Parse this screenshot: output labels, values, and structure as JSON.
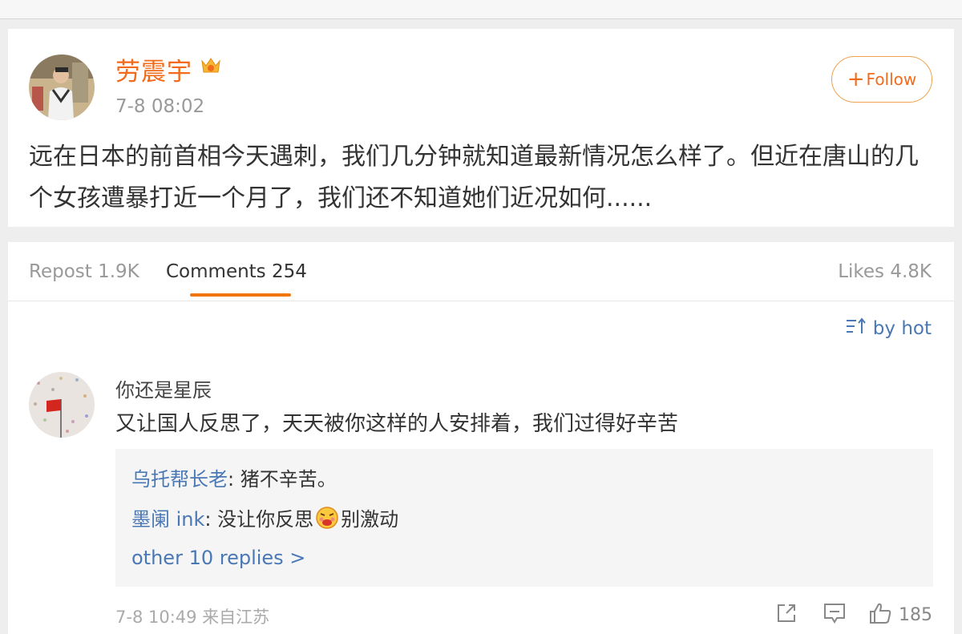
{
  "post": {
    "author": "劳震宇",
    "time": "7-8 08:02",
    "follow_label": "Follow",
    "text": "远在日本的前首相今天遇刺，我们几分钟就知道最新情况怎么样了。但近在唐山的几个女孩遭暴打近一个月了，我们还不知道她们近况如何......"
  },
  "tabs": {
    "repost": "Repost 1.9K",
    "comments": "Comments 254",
    "likes": "Likes 4.8K"
  },
  "sort_label": "by hot",
  "comment": {
    "username": "你还是星辰",
    "text": "又让国人反思了，天天被你这样的人安排着，我们过得好辛苦",
    "replies": [
      {
        "name": "乌托帮长老",
        "text": ": 猪不辛苦。"
      },
      {
        "name": "墨阑 ink",
        "text_before": ": 没让你反思",
        "text_after": "别激动"
      }
    ],
    "more_replies": "other 10 replies >",
    "meta": "7-8 10:49  来自江苏",
    "likes": "185"
  },
  "colors": {
    "brand_orange": "#f26b1d",
    "link_blue": "#4a78b5"
  }
}
